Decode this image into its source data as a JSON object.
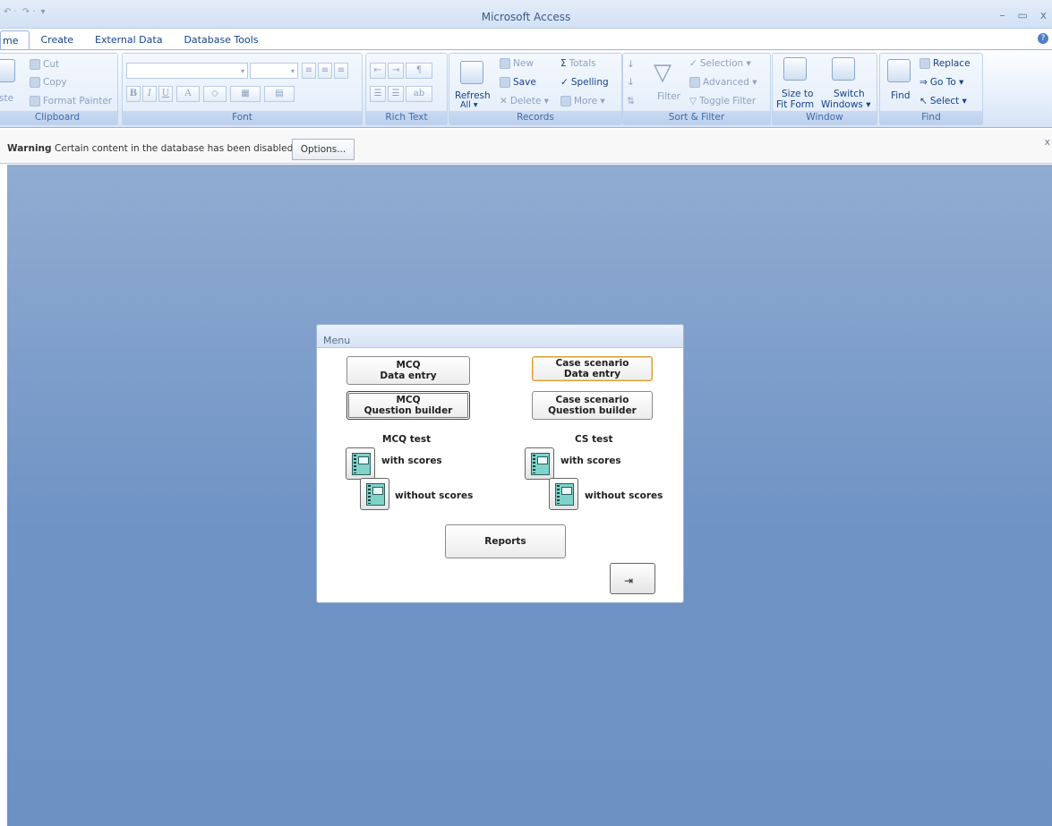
{
  "window": {
    "title": "Microsoft Access",
    "controls": [
      "–",
      "▭",
      "x"
    ]
  },
  "qat": {
    "undo": "↶ ·",
    "redo": "↷ ·",
    "customize": "▾"
  },
  "tabs": [
    "me",
    "Create",
    "External Data",
    "Database Tools"
  ],
  "help_glyph": "?",
  "ribbon": {
    "clipboard": {
      "label": "Clipboard",
      "paste": "ste",
      "cut": "Cut",
      "copy": "Copy",
      "format_painter": "Format Painter"
    },
    "font": {
      "label": "Font",
      "bold": "B",
      "italic": "I",
      "underline": "U",
      "font_color": "A"
    },
    "rich_text": {
      "label": "Rich Text"
    },
    "records": {
      "label": "Records",
      "refresh": "Refresh",
      "refresh_sub": "All ▾",
      "new": "New",
      "save": "Save",
      "delete": "Delete ▾",
      "totals": "Totals",
      "spelling": "Spelling",
      "more": "More ▾"
    },
    "sort_filter": {
      "label": "Sort & Filter",
      "filter": "Filter",
      "selection": "Selection ▾",
      "advanced": "Advanced ▾",
      "toggle_filter": "Toggle Filter"
    },
    "window": {
      "label": "Window",
      "size_to_fit_1": "Size to",
      "size_to_fit_2": "Fit Form",
      "switch_1": "Switch",
      "switch_2": "Windows ▾"
    },
    "find": {
      "label": "Find",
      "find": "Find",
      "replace": "Replace",
      "goto": "Go To ▾",
      "select": "Select ▾"
    }
  },
  "warning": {
    "label": "Warning",
    "text": "Certain content in the database has been disabled",
    "options_button": "Options...",
    "close": "x"
  },
  "form": {
    "title": "Menu",
    "mcq_data_entry": [
      "MCQ",
      "Data entry"
    ],
    "case_data_entry": [
      "Case scenario",
      "Data entry"
    ],
    "mcq_question_builder": [
      "MCQ",
      "Question builder"
    ],
    "case_question_builder": [
      "Case scenario",
      "Question builder"
    ],
    "mcq_test_label": "MCQ test",
    "cs_test_label": "CS test",
    "with_scores": "with scores",
    "without_scores": "without scores",
    "reports": "Reports",
    "exit_glyph": "⇥"
  }
}
